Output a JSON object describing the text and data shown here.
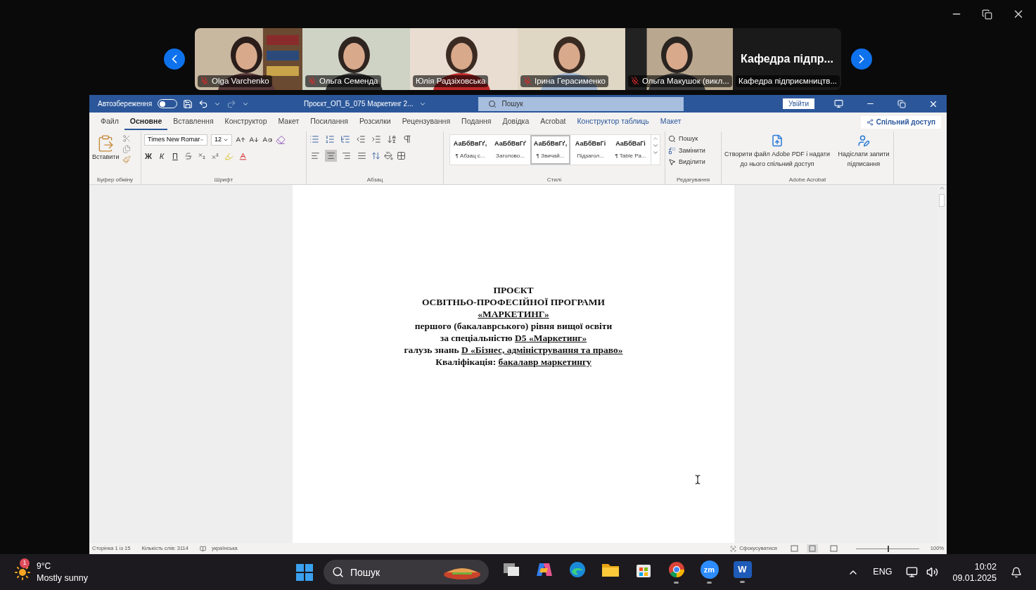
{
  "meeting": {
    "participants": [
      {
        "kind": "video",
        "name": "Olga Varchenko",
        "muted": true
      },
      {
        "kind": "video",
        "name": "Ольга Семенда",
        "muted": true
      },
      {
        "kind": "video",
        "name": "Юлія Радзіховська",
        "muted": false
      },
      {
        "kind": "video",
        "name": "Ірина Герасименко",
        "muted": true
      },
      {
        "kind": "video",
        "name": "Ольга Макушок (викл...",
        "muted": true
      },
      {
        "kind": "name",
        "title": "Кафедра підпр...",
        "name": "Кафедра підприємництв..."
      }
    ]
  },
  "word": {
    "autosave": {
      "label": "Автозбереження",
      "on": false
    },
    "document_title": "Проєкт_ОП_Б_075 Маркетинг 2...",
    "search": {
      "placeholder": "Пошук"
    },
    "sign_in": "Увійти",
    "tabs": [
      {
        "label": "Файл",
        "selected": false,
        "kind": "main"
      },
      {
        "label": "Основне",
        "selected": true,
        "kind": "main"
      },
      {
        "label": "Вставлення",
        "selected": false,
        "kind": "main"
      },
      {
        "label": "Конструктор",
        "selected": false,
        "kind": "main"
      },
      {
        "label": "Макет",
        "selected": false,
        "kind": "main"
      },
      {
        "label": "Посилання",
        "selected": false,
        "kind": "main"
      },
      {
        "label": "Розсилки",
        "selected": false,
        "kind": "main"
      },
      {
        "label": "Рецензування",
        "selected": false,
        "kind": "main"
      },
      {
        "label": "Подання",
        "selected": false,
        "kind": "main"
      },
      {
        "label": "Довідка",
        "selected": false,
        "kind": "main"
      },
      {
        "label": "Acrobat",
        "selected": false,
        "kind": "main"
      },
      {
        "label": "Конструктор таблиць",
        "selected": false,
        "kind": "context"
      },
      {
        "label": "Макет",
        "selected": false,
        "kind": "context"
      }
    ],
    "share": "Спільний доступ",
    "ribbon": {
      "clipboard": {
        "paste": "Вставити",
        "label": "Буфер обміну"
      },
      "font": {
        "name": "Times New Romar",
        "size": "12",
        "format_buttons": [
          "Ж",
          "К",
          "П"
        ],
        "label": "Шрифт"
      },
      "paragraph": {
        "alignments": [
          {
            "kind": "left",
            "selected": false
          },
          {
            "kind": "center",
            "selected": true
          },
          {
            "kind": "right",
            "selected": false
          },
          {
            "kind": "justify",
            "selected": false
          }
        ],
        "label": "Абзац"
      },
      "styles": {
        "items": [
          {
            "sample": "АаБбВвГґ,",
            "name": "¶ Абзац с...",
            "selected": false
          },
          {
            "sample": "АаБбВвГґ",
            "name": "Заголово...",
            "selected": false
          },
          {
            "sample": "АаБбВвГґ,",
            "name": "¶ Звичай...",
            "selected": true
          },
          {
            "sample": "АаБбВвГі",
            "name": "Підзагол...",
            "selected": false
          },
          {
            "sample": "АаБбВаГі",
            "name": "¶ Table Pa...",
            "selected": false
          }
        ],
        "label": "Стилі"
      },
      "editing": {
        "find": "Пошук",
        "replace": "Замінити",
        "select": "Виділити",
        "label": "Редагування"
      },
      "acrobat": {
        "create_pdf": "Створити файл Adobe PDF і надати до нього спільний доступ",
        "request_signatures": "Надіслати запити підписання",
        "label": "Adobe Acrobat"
      }
    },
    "document": {
      "lines": [
        {
          "parts": [
            {
              "text": "ПРОЄКТ",
              "underlined": false
            }
          ]
        },
        {
          "parts": [
            {
              "text": "ОСВІТНЬО-ПРОФЕСІЙНОЇ ПРОГРАМИ",
              "underlined": false
            }
          ]
        },
        {
          "parts": [
            {
              "text": "«МАРКЕТИНГ»",
              "underlined": true
            }
          ]
        },
        {
          "parts": [
            {
              "text": "першого (бакалаврського) рівня вищої освіти",
              "underlined": false
            }
          ]
        },
        {
          "parts": [
            {
              "text": "за спеціальністю ",
              "underlined": false
            },
            {
              "text": "D5 «Маркетинг»",
              "underlined": true
            }
          ]
        },
        {
          "parts": [
            {
              "text": "галузь знань ",
              "underlined": false
            },
            {
              "text": "D «Бізнес, адміністрування та право»",
              "underlined": true
            }
          ]
        },
        {
          "parts": [
            {
              "text": "Кваліфікація: ",
              "underlined": false
            },
            {
              "text": "бакалавр маркетингу",
              "underlined": true
            }
          ]
        }
      ]
    },
    "status_bar": {
      "page": "Сторінка 1 із 15",
      "words": "Кількість слів: 3114",
      "language": "українська",
      "focus": "Сфокусуватися",
      "zoom": "100%",
      "zoom_slider": {
        "level": 0.5
      }
    }
  },
  "taskbar": {
    "weather": {
      "badge": "1",
      "temperature": "9°C",
      "condition": "Mostly sunny"
    },
    "search": {
      "placeholder": "Пошук"
    },
    "apps": [
      {
        "kind": "taskview",
        "running": false
      },
      {
        "kind": "copilot",
        "running": false
      },
      {
        "kind": "edge",
        "running": false
      },
      {
        "kind": "explorer",
        "running": false
      },
      {
        "kind": "store",
        "running": false
      },
      {
        "kind": "chrome",
        "running": true
      },
      {
        "kind": "zoom",
        "label": "zm",
        "running": true
      },
      {
        "kind": "word",
        "label": "W",
        "running": true
      }
    ],
    "language": "ENG",
    "time": "10:02",
    "date": "09.01.2025"
  }
}
